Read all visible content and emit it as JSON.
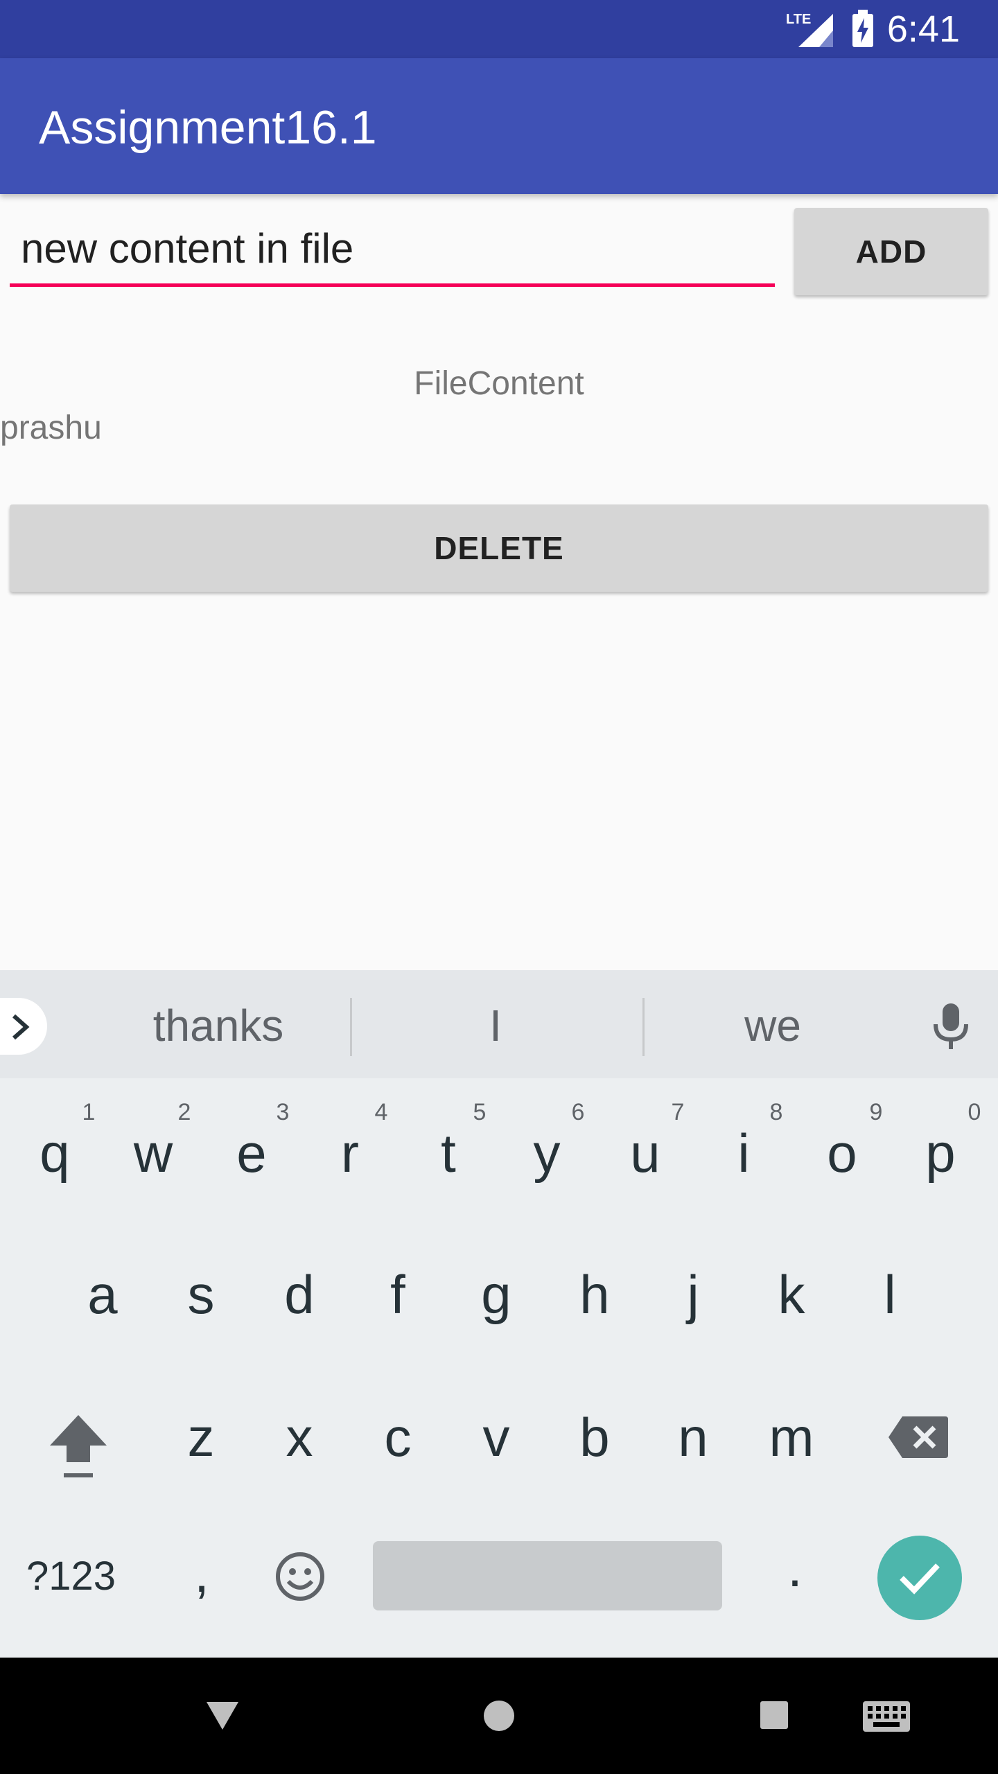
{
  "status_bar": {
    "time": "6:41",
    "network_label": "LTE",
    "icons": [
      "lte-signal-icon",
      "battery-charging-icon"
    ]
  },
  "app_bar": {
    "title": "Assignment16.1"
  },
  "input": {
    "value": "new content in file"
  },
  "buttons": {
    "add": "ADD",
    "delete": "DELETE"
  },
  "file_content": {
    "title": "FileContent",
    "body": "prashu"
  },
  "keyboard": {
    "suggestions": [
      "thanks",
      "I",
      "we"
    ],
    "row1": [
      "q",
      "w",
      "e",
      "r",
      "t",
      "y",
      "u",
      "i",
      "o",
      "p"
    ],
    "row1_hints": [
      "1",
      "2",
      "3",
      "4",
      "5",
      "6",
      "7",
      "8",
      "9",
      "0"
    ],
    "row2": [
      "a",
      "s",
      "d",
      "f",
      "g",
      "h",
      "j",
      "k",
      "l"
    ],
    "row3": [
      "z",
      "x",
      "c",
      "v",
      "b",
      "n",
      "m"
    ],
    "symbols_key": "?123",
    "comma_key": ",",
    "period_key": ".",
    "accent_color": "#4db6ac"
  },
  "colors": {
    "status_bar": "#303f9f",
    "app_bar": "#3f51b5",
    "input_underline": "#f50057"
  },
  "nav_bar": {
    "icons": [
      "back-icon",
      "home-icon",
      "recents-icon",
      "keyboard-switch-icon"
    ]
  }
}
